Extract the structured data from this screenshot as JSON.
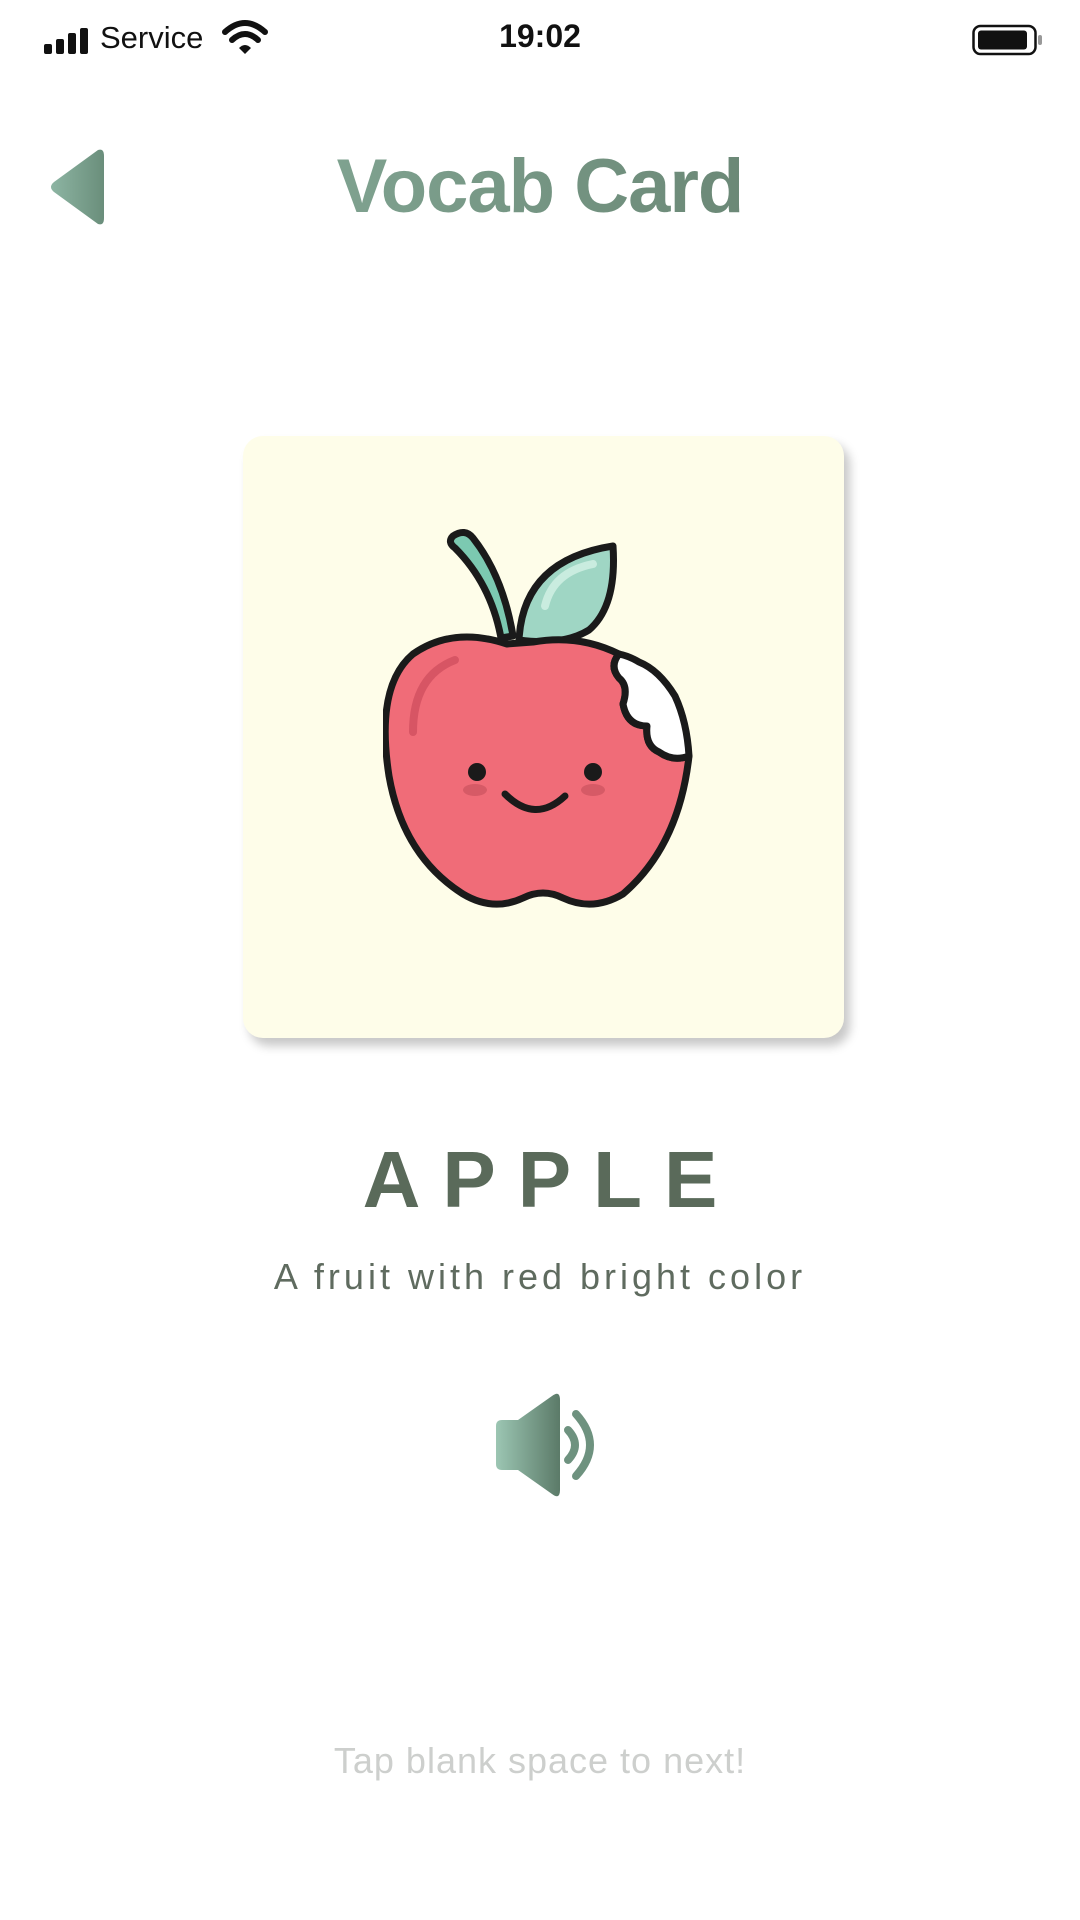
{
  "status_bar": {
    "carrier": "Service",
    "time": "19:02",
    "battery_icon": "battery-icon",
    "signal_icon": "signal-bars-icon",
    "wifi_icon": "wifi-icon"
  },
  "header": {
    "title": "Vocab Card",
    "back_icon": "back-triangle-icon"
  },
  "card": {
    "image_icon": "apple-illustration",
    "background_color": "#fefde9"
  },
  "word": {
    "text": "APPLE",
    "definition": "A fruit with red bright color"
  },
  "audio": {
    "icon": "speaker-icon"
  },
  "hint": {
    "text": "Tap blank space to next!"
  },
  "colors": {
    "accent_light": "#8fb7a4",
    "accent_dark": "#5b7362",
    "word_color": "#5a6a5a",
    "apple_red": "#f06c78",
    "leaf_green": "#9fd6c4"
  }
}
